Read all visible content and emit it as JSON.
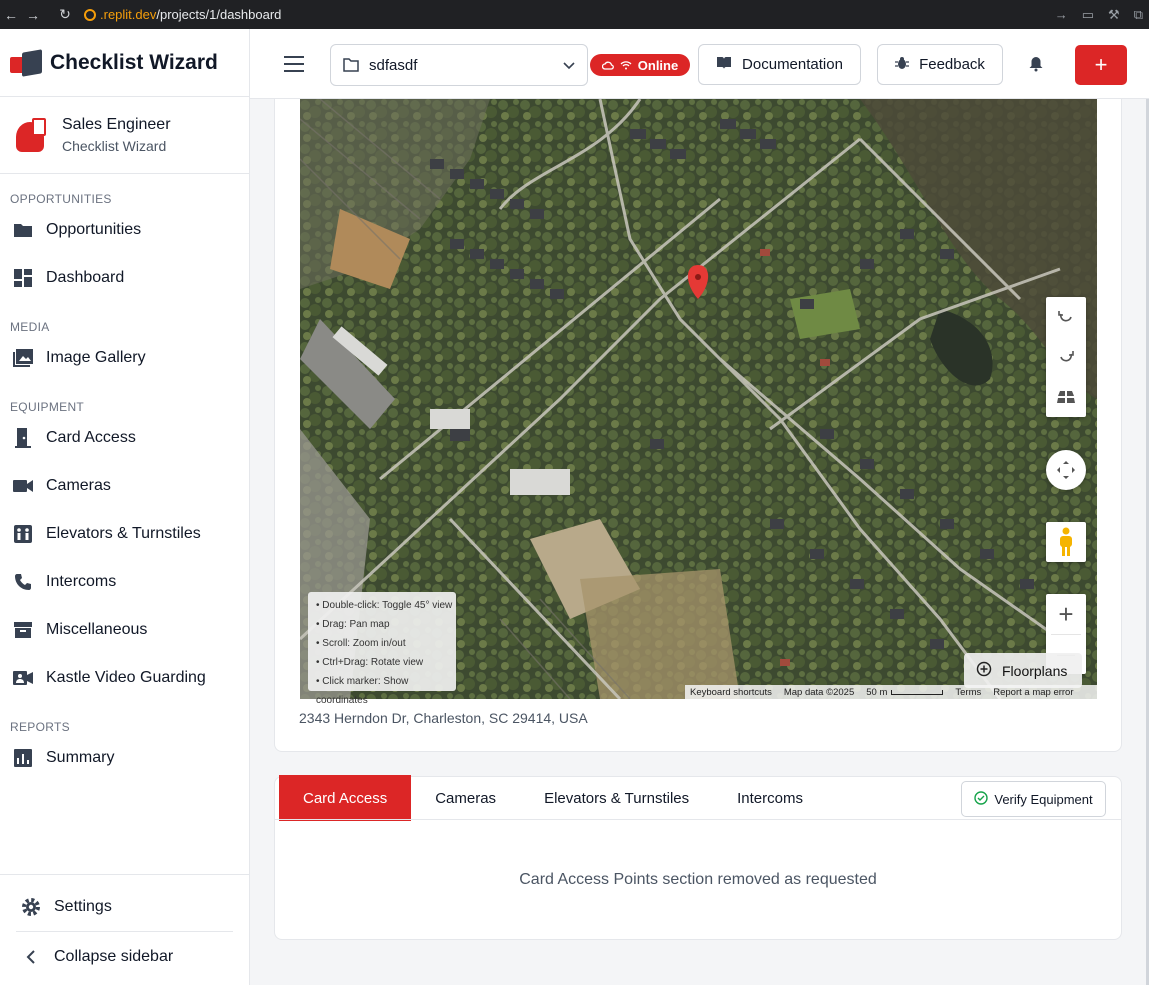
{
  "browser": {
    "url_host": ".replit.dev",
    "url_path": "/projects/1/dashboard"
  },
  "brand": {
    "title": "Checklist Wizard"
  },
  "profile": {
    "name": "Sales Engineer",
    "subtitle": "Checklist Wizard"
  },
  "sidebar": {
    "sections": {
      "opportunities": "OPPORTUNITIES",
      "media": "MEDIA",
      "equipment": "EQUIPMENT",
      "reports": "REPORTS"
    },
    "items": {
      "opportunities": "Opportunities",
      "dashboard": "Dashboard",
      "image_gallery": "Image Gallery",
      "card_access": "Card Access",
      "cameras": "Cameras",
      "elevators": "Elevators & Turnstiles",
      "intercoms": "Intercoms",
      "misc": "Miscellaneous",
      "kastle": "Kastle Video Guarding",
      "summary": "Summary"
    },
    "settings": "Settings",
    "collapse": "Collapse sidebar"
  },
  "header": {
    "project": "sdfasdf",
    "status": "Online",
    "documentation": "Documentation",
    "feedback": "Feedback",
    "add": "+"
  },
  "map": {
    "help": [
      "• Double-click: Toggle 45° view",
      "• Drag: Pan map",
      "• Scroll: Zoom in/out",
      "• Ctrl+Drag: Rotate view",
      "• Click marker: Show coordinates"
    ],
    "floorplans": "Floorplans",
    "attribution": {
      "shortcuts": "Keyboard shortcuts",
      "data": "Map data ©2025",
      "scale": "50 m",
      "terms": "Terms",
      "report": "Report a map error"
    },
    "zoom_in": "+",
    "zoom_out": "—",
    "address": "2343 Herndon Dr, Charleston, SC 29414, USA"
  },
  "tabs": {
    "items": [
      "Card Access",
      "Cameras",
      "Elevators & Turnstiles",
      "Intercoms"
    ],
    "verify": "Verify Equipment",
    "message": "Card Access Points section removed as requested"
  },
  "colors": {
    "accent": "#dc2626"
  }
}
